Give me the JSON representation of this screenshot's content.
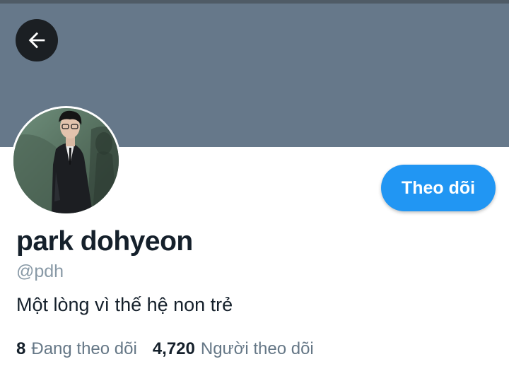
{
  "header": {
    "banner_color": "#66788a",
    "back_icon": "arrow-left-icon"
  },
  "profile": {
    "name": "park dohyeon",
    "handle": "@pdh",
    "bio": "Một lòng vì thế hệ non trẻ",
    "follow_label": "Theo dõi",
    "accent_color": "#2196f3"
  },
  "stats": {
    "following_count": "8",
    "following_label": "Đang theo dõi",
    "followers_count": "4,720",
    "followers_label": "Người theo dõi"
  }
}
